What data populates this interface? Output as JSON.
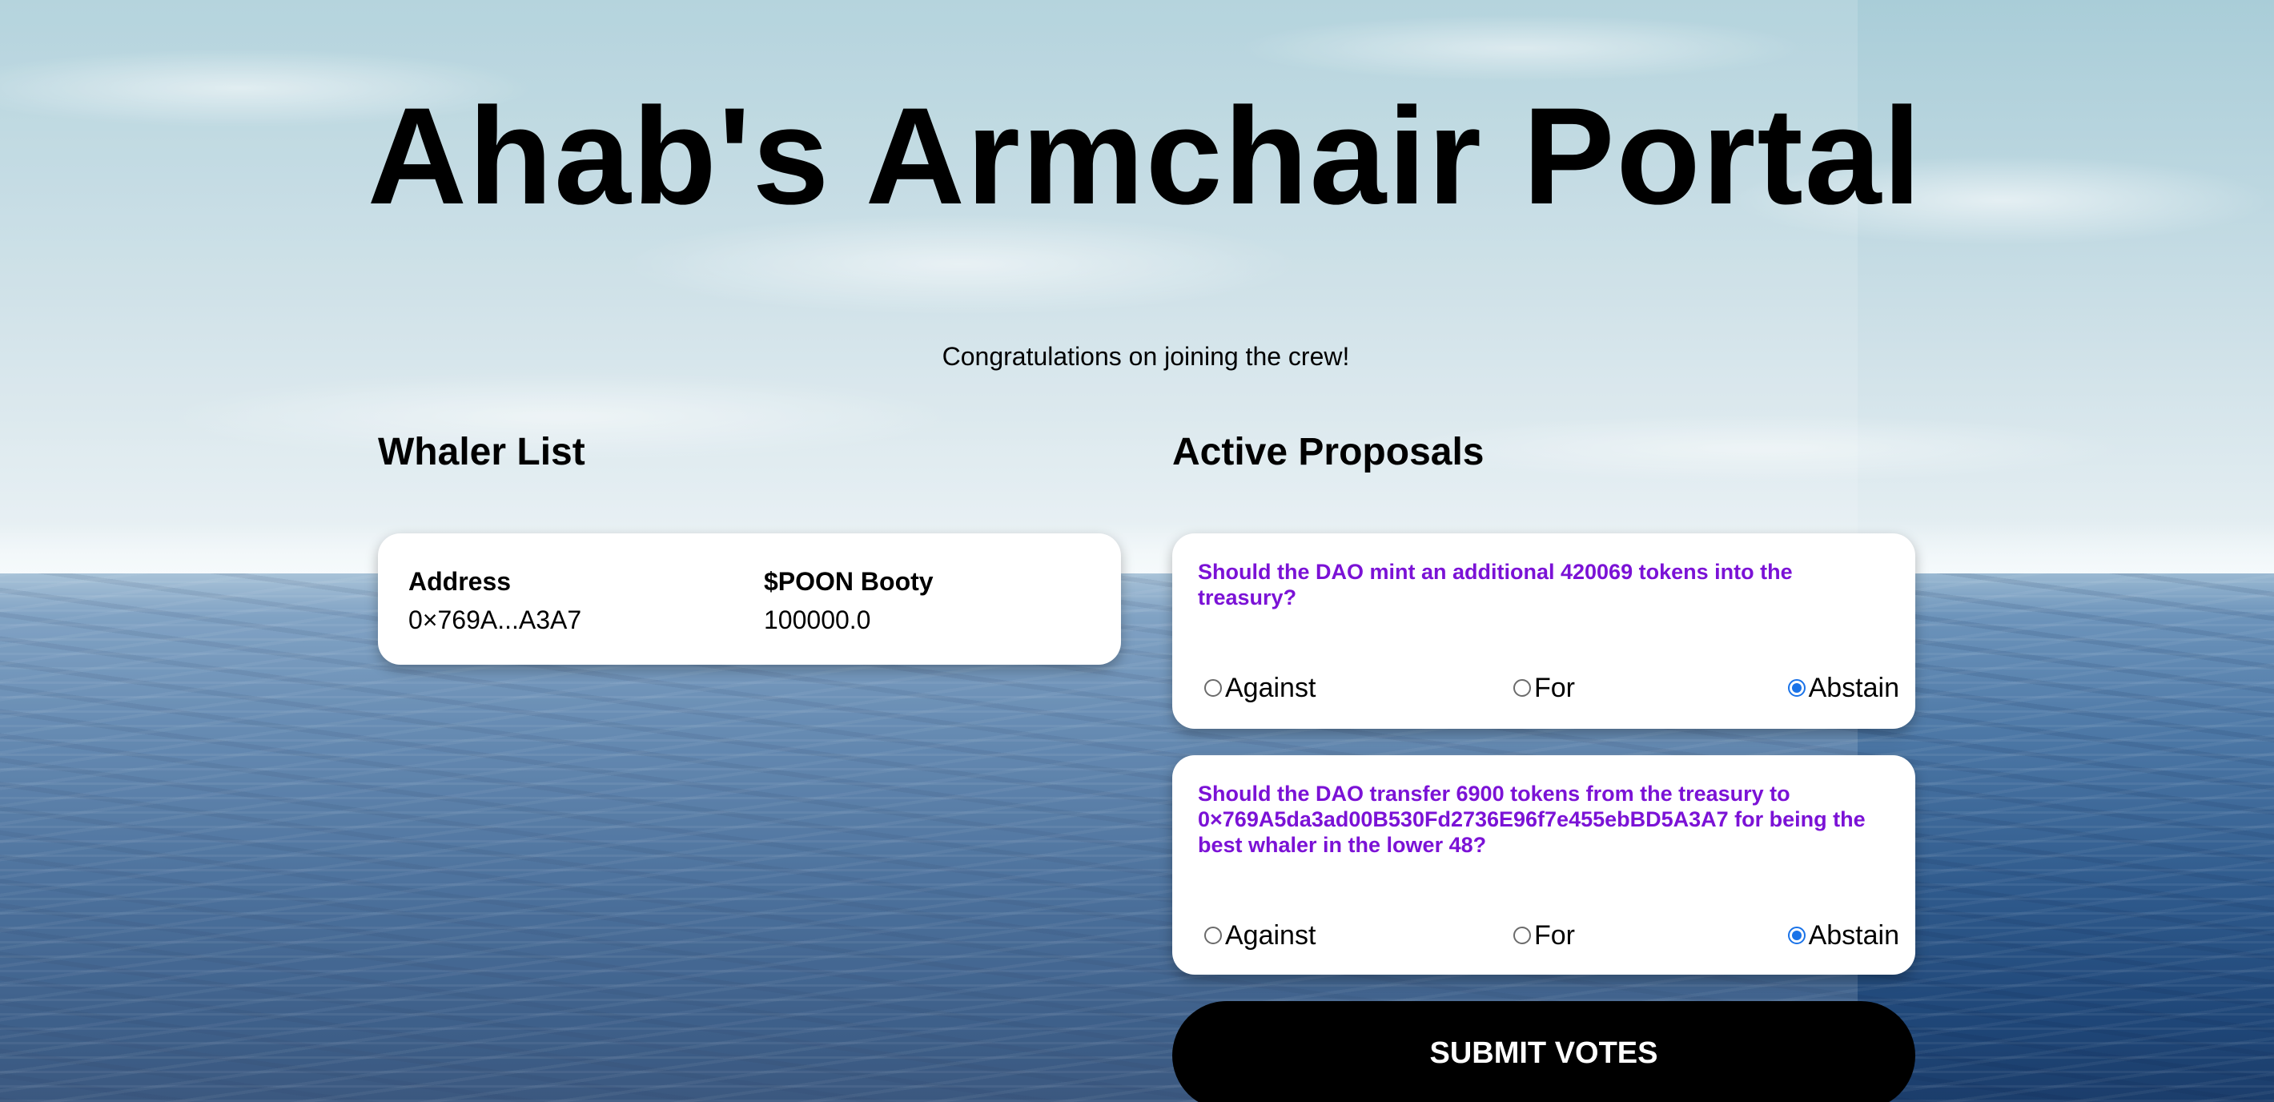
{
  "page": {
    "title": "Ahab's Armchair Portal",
    "subtitle": "Congratulations on joining the crew!"
  },
  "whaler_list": {
    "heading": "Whaler List",
    "columns": [
      "Address",
      "$POON Booty"
    ],
    "rows": [
      {
        "address": "0×769A...A3A7",
        "booty": "100000.0"
      }
    ]
  },
  "proposals": {
    "heading": "Active Proposals",
    "items": [
      {
        "question": "Should the DAO mint an additional 420069 tokens into the treasury?",
        "options": [
          "Against",
          "For",
          "Abstain"
        ],
        "selected": "Abstain"
      },
      {
        "question": "Should the DAO transfer 6900 tokens from the treasury to 0×769A5da3ad00B530Fd2736E96f7e455ebBD5A3A7 for being the best whaler in the lower 48?",
        "options": [
          "Against",
          "For",
          "Abstain"
        ],
        "selected": "Abstain"
      }
    ]
  },
  "submit": {
    "label": "SUBMIT VOTES"
  },
  "colors": {
    "question_text": "#7b12d6",
    "radio_checked": "#1a73e8",
    "button_bg": "#000000",
    "button_text": "#ffffff",
    "card_bg": "#ffffff"
  },
  "background": {
    "description_icon": "ocean-horizon-image"
  }
}
